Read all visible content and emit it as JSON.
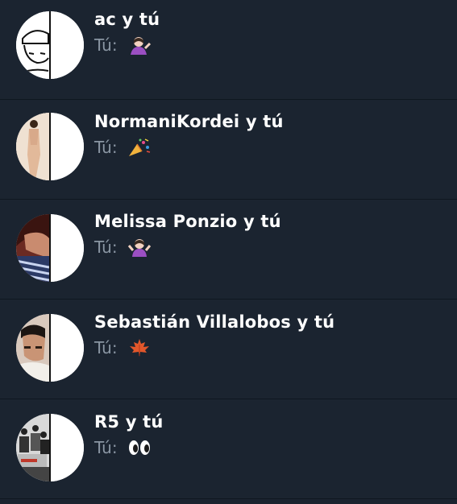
{
  "conversations": [
    {
      "name": "ac y tú",
      "prefix": "Tú:",
      "emoji": "person-tipping-hand-emoji"
    },
    {
      "name": "NormaniKordei y tú",
      "prefix": "Tú:",
      "emoji": "party-popper-emoji"
    },
    {
      "name": "Melissa Ponzio y tú",
      "prefix": "Tú:",
      "emoji": "person-shrugging-emoji"
    },
    {
      "name": "Sebastián Villalobos y tú",
      "prefix": "Tú:",
      "emoji": "maple-leaf-emoji"
    },
    {
      "name": "R5 y tú",
      "prefix": "Tú:",
      "emoji": "eyes-emoji"
    }
  ],
  "colors": {
    "background": "#1b2430",
    "divider": "#0f1720",
    "name": "#ffffff",
    "preview": "#8a96a3"
  }
}
